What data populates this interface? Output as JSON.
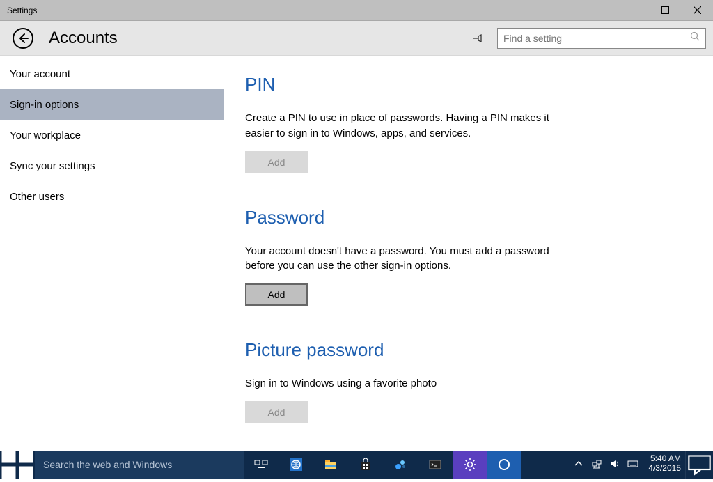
{
  "window": {
    "title": "Settings"
  },
  "header": {
    "page_title": "Accounts",
    "search_placeholder": "Find a setting"
  },
  "sidebar": {
    "items": [
      {
        "label": "Your account",
        "selected": false
      },
      {
        "label": "Sign-in options",
        "selected": true
      },
      {
        "label": "Your workplace",
        "selected": false
      },
      {
        "label": "Sync your settings",
        "selected": false
      },
      {
        "label": "Other users",
        "selected": false
      }
    ]
  },
  "content": {
    "pin": {
      "heading": "PIN",
      "desc": "Create a PIN to use in place of passwords. Having a PIN makes it easier to sign in to Windows, apps, and services.",
      "button": "Add"
    },
    "password": {
      "heading": "Password",
      "desc": "Your account doesn't have a password. You must add a password before you can use the other sign-in options.",
      "button": "Add"
    },
    "picture": {
      "heading": "Picture password",
      "desc": "Sign in to Windows using a favorite photo",
      "button": "Add"
    }
  },
  "taskbar": {
    "search_placeholder": "Search the web and Windows",
    "time": "5:40 AM",
    "date": "4/3/2015"
  }
}
